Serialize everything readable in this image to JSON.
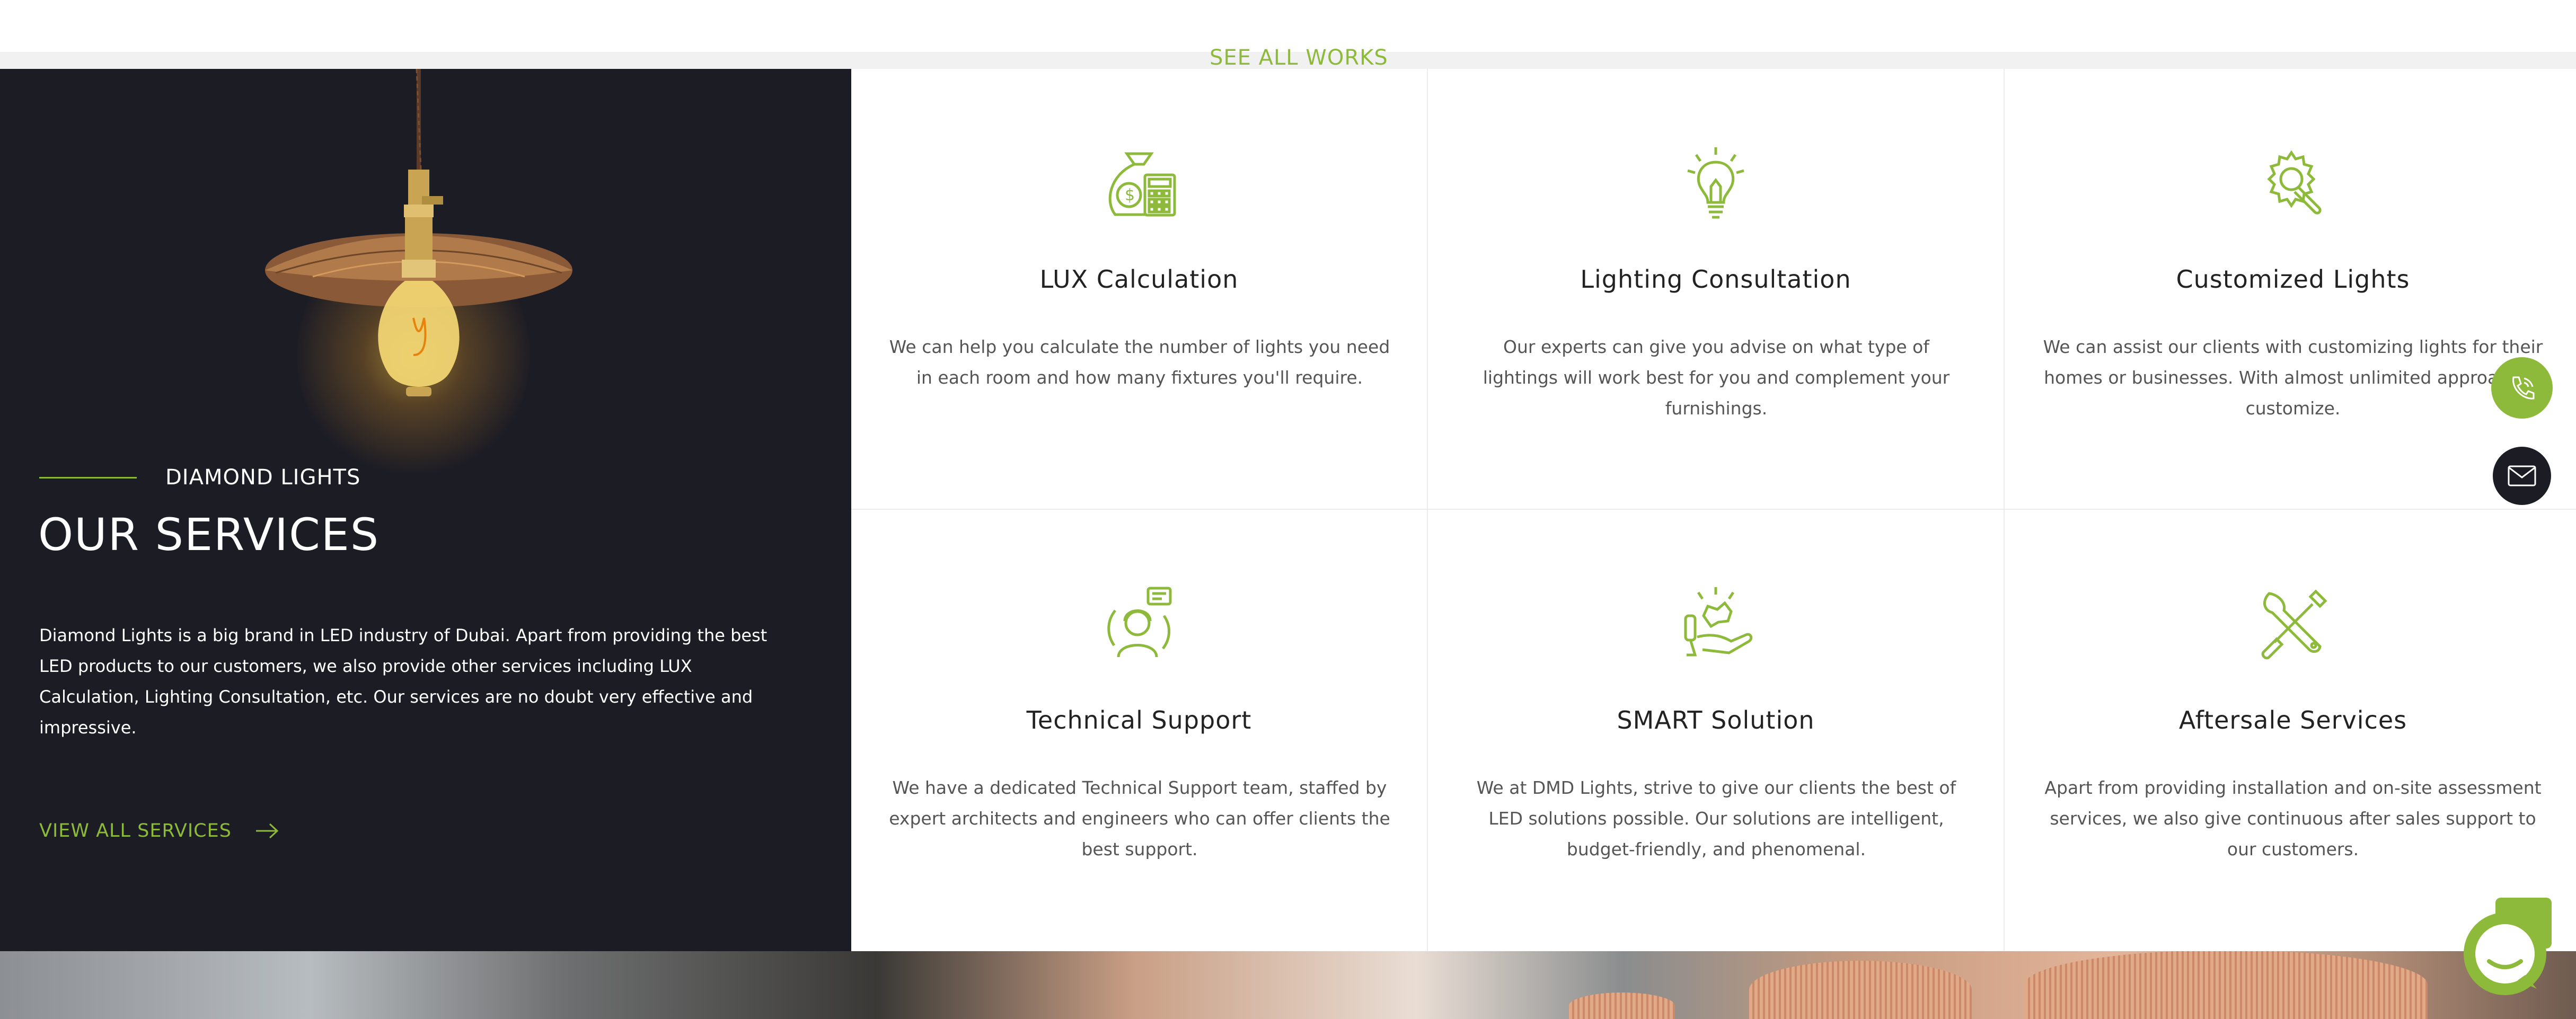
{
  "header": {
    "see_all_works": "SEE ALL WORKS"
  },
  "intro": {
    "overline": "DIAMOND LIGHTS",
    "title": "OUR SERVICES",
    "description": "Diamond Lights is a big brand in LED industry of Dubai. Apart from providing the best LED products to our customers, we also provide other services including LUX Calculation, Lighting Consultation, etc. Our services are no doubt very effective and impressive.",
    "cta": "VIEW ALL SERVICES",
    "cta_icon": "arrow-right-icon"
  },
  "services": [
    {
      "icon": "money-bag-calculator-icon",
      "title": "LUX Calculation",
      "description": "We can help you calculate the number of lights you need in each room and how many fixtures you'll require."
    },
    {
      "icon": "lightbulb-icon",
      "title": "Lighting Consultation",
      "description": "Our experts can give you advise on what type of lightings will work best for you and complement your furnishings."
    },
    {
      "icon": "gear-wrench-icon",
      "title": "Customized Lights",
      "description": "We can assist our clients with customizing lights for their homes or businesses. With almost unlimited approach to customize."
    },
    {
      "icon": "support-agent-icon",
      "title": "Technical Support",
      "description": "We have a dedicated Technical Support team, staffed by expert architects and engineers who can offer clients the best support."
    },
    {
      "icon": "smart-hand-icon",
      "title": "SMART Solution",
      "description": "We at DMD Lights, strive to give our clients the best of LED solutions possible. Our solutions are intelligent, budget-friendly, and phenomenal."
    },
    {
      "icon": "wrench-screwdriver-icon",
      "title": "Aftersale Services",
      "description": "Apart from providing installation and on-site assessment services, we also give continuous after sales support to our customers."
    }
  ],
  "floating": {
    "phone_icon": "phone-icon",
    "mail_icon": "mail-icon",
    "chat_icon": "chat-icon"
  },
  "colors": {
    "accent": "#8dba3a",
    "dark": "#1c1c25",
    "card_text": "#555555",
    "title_text": "#222222"
  }
}
